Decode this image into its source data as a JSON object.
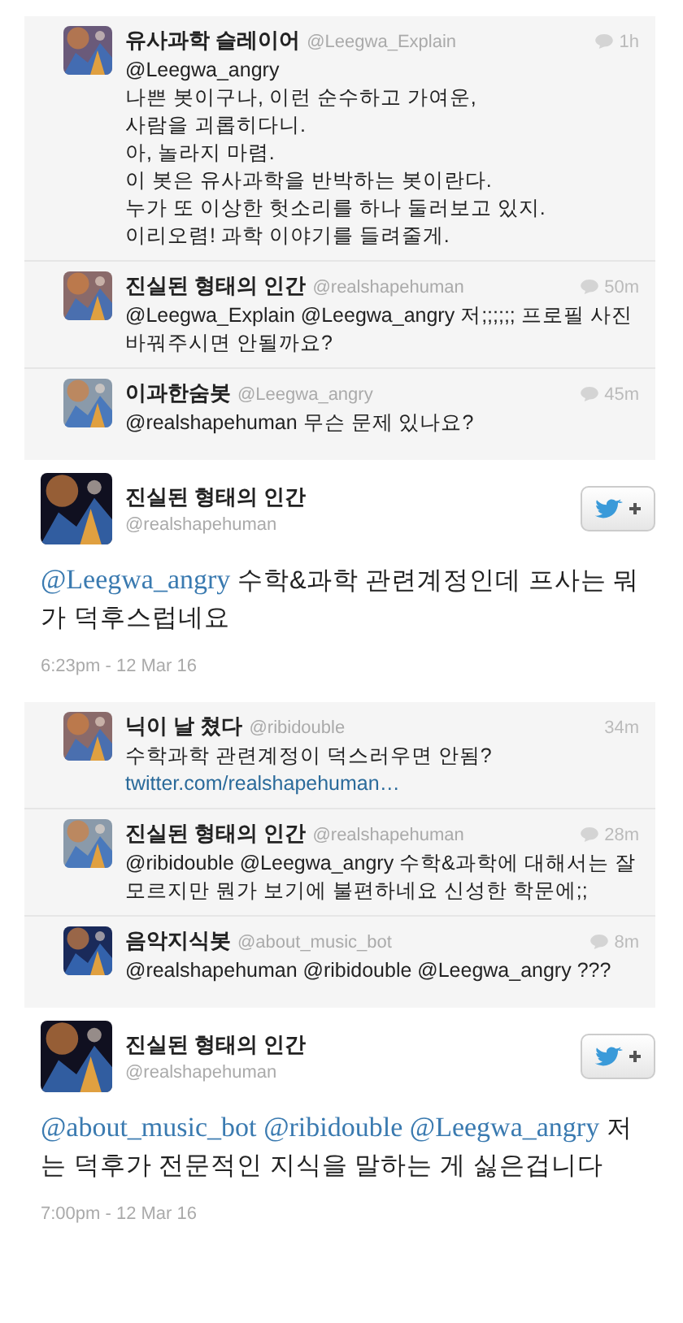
{
  "sections": [
    {
      "kind": "replies",
      "items": [
        {
          "name": "유사과학 슬레이어",
          "handle": "@Leegwa_Explain",
          "time": "1h",
          "reply_icon": true,
          "text": "@Leegwa_angry\n나쁜 봇이구나, 이런 순수하고 가여운,\n사람을 괴롭히다니.\n아, 놀라지 마렴.\n이 봇은 유사과학을 반박하는 봇이란다.\n누가 또 이상한 헛소리를 하나 둘러보고 있지.\n이리오렴! 과학 이야기를 들려줄게."
        },
        {
          "name": "진실된 형태의 인간",
          "handle": "@realshapehuman",
          "time": "50m",
          "reply_icon": true,
          "text": "@Leegwa_Explain @Leegwa_angry 저;;;;;; 프로필 사진 바꿔주시면 안될까요?"
        },
        {
          "name": "이과한숨봇",
          "handle": "@Leegwa_angry",
          "time": "45m",
          "reply_icon": true,
          "text": "@realshapehuman 무슨 문제 있나요?"
        }
      ]
    },
    {
      "kind": "tweet",
      "name": "진실된 형태의 인간",
      "handle": "@realshapehuman",
      "body": [
        {
          "kind": "mention",
          "text": "@Leegwa_angry"
        },
        {
          "kind": "text",
          "text": "수학&과학 관련계정인데 프사는 뭐가 덕후스럽네요"
        }
      ],
      "timestamp": "6:23pm - 12 Mar 16"
    },
    {
      "kind": "replies",
      "items": [
        {
          "name": "닉이 날 쳤다",
          "handle": "@ribidouble",
          "time": "34m",
          "reply_icon": false,
          "text": "수학과학 관련계정이 덕스러우면 안됨?",
          "link": "twitter.com/realshapehuman…"
        },
        {
          "name": "진실된 형태의 인간",
          "handle": "@realshapehuman",
          "time": "28m",
          "reply_icon": true,
          "text": "@ribidouble @Leegwa_angry 수학&과학에 대해서는 잘모르지만 뭔가 보기에 불편하네요 신성한 학문에;;"
        },
        {
          "name": "음악지식봇",
          "handle": "@about_music_bot",
          "time": "8m",
          "reply_icon": true,
          "text": "@realshapehuman @ribidouble @Leegwa_angry ???"
        }
      ]
    },
    {
      "kind": "tweet",
      "name": "진실된 형태의 인간",
      "handle": "@realshapehuman",
      "body": [
        {
          "kind": "mention",
          "text": "@about_music_bot"
        },
        {
          "kind": "mention",
          "text": "@ribidouble"
        },
        {
          "kind": "mention",
          "text": "@Leegwa_angry"
        },
        {
          "kind": "text",
          "text": "저는 덕후가 전문적인 지식을 말하는 게 싫은겁니다"
        }
      ],
      "timestamp": "7:00pm - 12 Mar 16"
    }
  ]
}
